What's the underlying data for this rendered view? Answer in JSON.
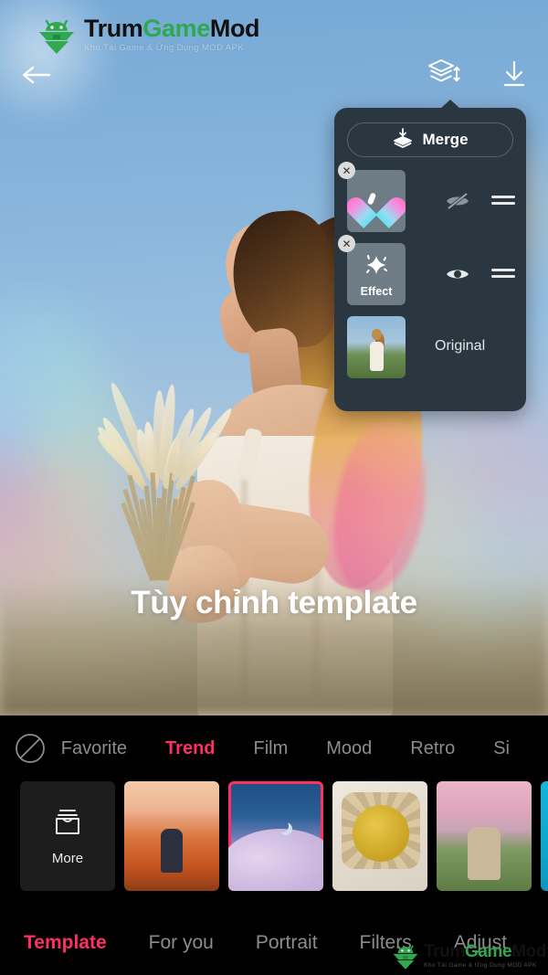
{
  "watermark": {
    "title_part1": "Trum",
    "title_part2": "Game",
    "title_part3": "Mod",
    "tagline": "Kho Tải Game & Ứng Dụng MOD APK",
    "logo_icon": "android-robot-logo",
    "green": "#2fa84f"
  },
  "topbar": {
    "back_icon": "back-arrow-icon",
    "layers_icon": "layers-reorder-icon",
    "download_icon": "download-icon"
  },
  "layers_panel": {
    "merge_label": "Merge",
    "merge_icon": "merge-layers-icon",
    "items": [
      {
        "name": "heart-sticker-layer",
        "thumb_icon": "gradient-heart-icon",
        "label": "",
        "visibility_icon": "eye-hidden-icon",
        "visible": false,
        "close_icon": "close-icon",
        "handle_icon": "drag-handle-icon"
      },
      {
        "name": "effect-layer",
        "thumb_icon": "sparkle-icon",
        "label": "Effect",
        "visibility_icon": "eye-visible-icon",
        "visible": true,
        "close_icon": "close-icon",
        "handle_icon": "drag-handle-icon"
      },
      {
        "name": "original-layer",
        "thumb_icon": "photo-thumbnail",
        "label": "Original"
      }
    ]
  },
  "overlay": {
    "headline": "Tùy chỉnh template"
  },
  "categories": {
    "none_icon": "no-filter-icon",
    "items": [
      {
        "label": "Favorite",
        "active": false
      },
      {
        "label": "Trend",
        "active": true
      },
      {
        "label": "Film",
        "active": false
      },
      {
        "label": "Mood",
        "active": false
      },
      {
        "label": "Retro",
        "active": false
      },
      {
        "label": "Si",
        "active": false
      }
    ]
  },
  "templates": {
    "more_label": "More",
    "more_icon": "archive-box-icon",
    "items": [
      {
        "name": "template-flower-field",
        "selected": false
      },
      {
        "name": "template-moon-clouds",
        "selected": true
      },
      {
        "name": "template-lemon-basket",
        "selected": false
      },
      {
        "name": "template-pink-sunset",
        "selected": false
      },
      {
        "name": "template-cyan",
        "selected": false
      }
    ]
  },
  "bottom_nav": [
    {
      "label": "Template",
      "active": true
    },
    {
      "label": "For you",
      "active": false
    },
    {
      "label": "Portrait",
      "active": false
    },
    {
      "label": "Filters",
      "active": false
    },
    {
      "label": "Adjust",
      "active": false
    }
  ],
  "colors": {
    "accent": "#ff2e63",
    "panel_bg": "#2b3740",
    "sheet_bg": "#000000"
  }
}
